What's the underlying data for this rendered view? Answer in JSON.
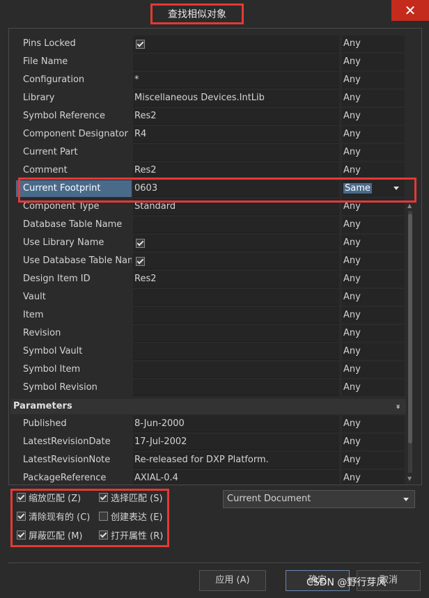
{
  "window": {
    "title": "查找相似对象",
    "close_glyph": "✕"
  },
  "properties": [
    {
      "name": "Pins Locked",
      "value": "",
      "checkbox": true,
      "op": "Any"
    },
    {
      "name": "File Name",
      "value": "",
      "op": "Any"
    },
    {
      "name": "Configuration",
      "value": "*",
      "op": "Any"
    },
    {
      "name": "Library",
      "value": "Miscellaneous Devices.IntLib",
      "op": "Any"
    },
    {
      "name": "Symbol Reference",
      "value": "Res2",
      "op": "Any"
    },
    {
      "name": "Component Designator",
      "value": "R4",
      "op": "Any"
    },
    {
      "name": "Current Part",
      "value": "",
      "op": "Any"
    },
    {
      "name": "Comment",
      "value": "Res2",
      "op": "Any"
    },
    {
      "name": "Current Footprint",
      "value": "0603",
      "op": "Same",
      "selected": true
    },
    {
      "name": "Component Type",
      "value": "Standard",
      "op": "Any"
    },
    {
      "name": "Database Table Name",
      "value": "",
      "op": "Any"
    },
    {
      "name": "Use Library Name",
      "value": "",
      "checkbox": true,
      "op": "Any"
    },
    {
      "name": "Use Database Table Name",
      "value": "",
      "checkbox": true,
      "op": "Any"
    },
    {
      "name": "Design Item ID",
      "value": "Res2",
      "op": "Any"
    },
    {
      "name": "Vault",
      "value": "",
      "op": "Any"
    },
    {
      "name": "Item",
      "value": "",
      "op": "Any"
    },
    {
      "name": "Revision",
      "value": "",
      "op": "Any"
    },
    {
      "name": "Symbol Vault",
      "value": "",
      "op": "Any"
    },
    {
      "name": "Symbol Item",
      "value": "",
      "op": "Any"
    },
    {
      "name": "Symbol Revision",
      "value": "",
      "op": "Any"
    }
  ],
  "parameters_section": {
    "label": "Parameters",
    "collapse_glyph": "»"
  },
  "parameters": [
    {
      "name": "Published",
      "value": "8-Jun-2000",
      "op": "Any"
    },
    {
      "name": "LatestRevisionDate",
      "value": "17-Jul-2002",
      "op": "Any"
    },
    {
      "name": "LatestRevisionNote",
      "value": "Re-released for DXP Platform.",
      "op": "Any"
    },
    {
      "name": "PackageReference",
      "value": "AXIAL-0.4",
      "op": "Any"
    }
  ],
  "options": {
    "zoom_matching": "缩放匹配 (Z)",
    "select_matching": "选择匹配 (S)",
    "clear_existing": "清除现有的 (C)",
    "create_expression": "创建表达 (E)",
    "mask_matching": "屏蔽匹配 (M)",
    "open_properties": "打开属性 (R)"
  },
  "scope": {
    "selected": "Current Document"
  },
  "buttons": {
    "apply": "应用 (A)",
    "ok": "确定",
    "cancel": "取消"
  },
  "watermark": "CSDN @野行芽风",
  "colors": {
    "highlight_border": "#e53935",
    "selection": "#4a6a8a",
    "background": "#2b2b2b"
  }
}
